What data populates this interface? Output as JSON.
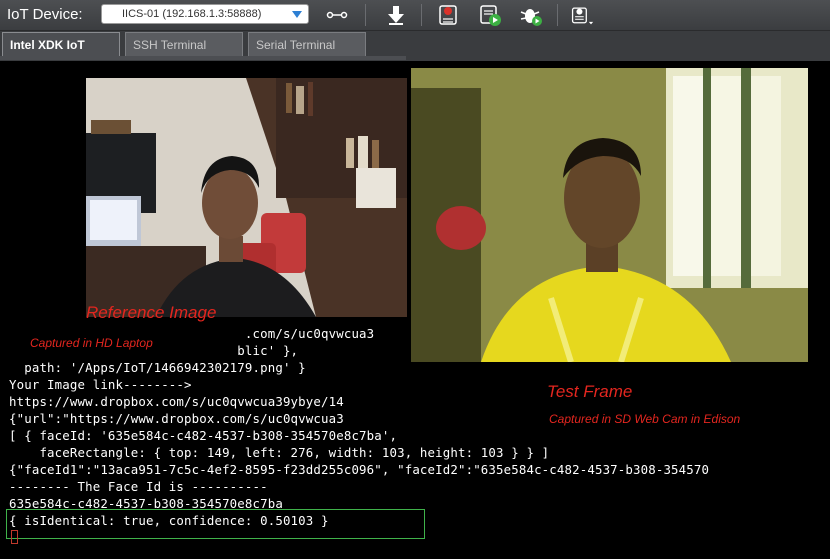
{
  "toolbar": {
    "label": "IoT Device:",
    "device_value": "IICS-01 (192.168.1.3:58888)",
    "icons": [
      "connect-icon",
      "download-icon",
      "stop-icon",
      "run-icon",
      "debug-icon",
      "settings-icon"
    ]
  },
  "tabs": [
    {
      "label": "Intel XDK IoT"
    },
    {
      "label": "SSH Terminal"
    },
    {
      "label": "Serial Terminal"
    }
  ],
  "terminal": {
    "lines": [
      "                               .com/s/uc0qvwcua3",
      "                              blic' },",
      "  path: '/Apps/IoT/1466942302179.png' }",
      "Your Image link-------->",
      "https://www.dropbox.com/s/uc0qvwcua39ybye/14",
      "{\"url\":\"https://www.dropbox.com/s/uc0qvwcua3",
      "[ { faceId: '635e584c-c482-4537-b308-354570e8c7ba',",
      "    faceRectangle: { top: 149, left: 276, width: 103, height: 103 } } ]",
      "{\"faceId1\":\"13aca951-7c5c-4ef2-8595-f23dd255c096\", \"faceId2\":\"635e584c-c482-4537-b308-354570",
      "-------- The Face Id is ----------",
      "635e584c-c482-4537-b308-354570e8c7ba",
      "{ isIdentical: true, confidence: 0.50103 }"
    ]
  },
  "annotations": {
    "reference_title": "Reference Image",
    "reference_caption": "Captured in HD Laptop",
    "test_title": "Test Frame",
    "test_caption": "Captured in SD Web Cam in Edison"
  },
  "colors": {
    "annotation": "#e3261f",
    "result_box": "#3fb24a",
    "toolbar": "#45474a"
  }
}
